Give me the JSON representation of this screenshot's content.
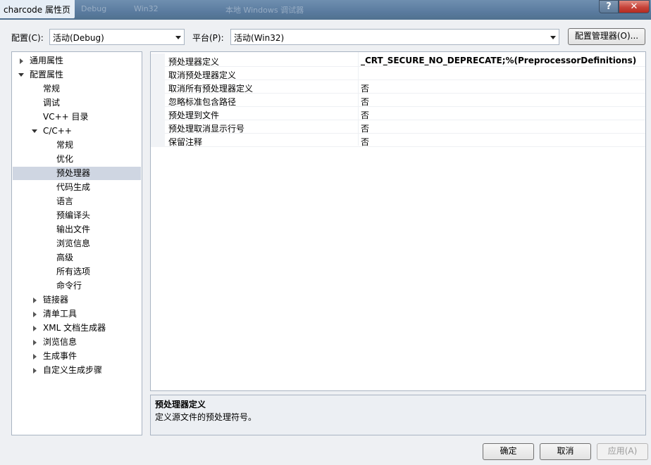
{
  "window": {
    "title": "charcode 属性页",
    "help_label": "?",
    "close_label": "✕"
  },
  "background_ghost": [
    "Debug",
    "Win32",
    "本地 Windows 调试器"
  ],
  "config_row": {
    "config_label": "配置(C):",
    "config_value": "活动(Debug)",
    "platform_label": "平台(P):",
    "platform_value": "活动(Win32)",
    "manager_button": "配置管理器(O)..."
  },
  "tree": {
    "items": [
      {
        "label": "通用属性",
        "expander": "closed"
      },
      {
        "label": "配置属性",
        "expander": "open"
      },
      {
        "label": "常规"
      },
      {
        "label": "调试"
      },
      {
        "label": "VC++ 目录"
      },
      {
        "label": "C/C++",
        "expander": "open"
      },
      {
        "label": "常规"
      },
      {
        "label": "优化"
      },
      {
        "label": "预处理器",
        "selected": true
      },
      {
        "label": "代码生成"
      },
      {
        "label": "语言"
      },
      {
        "label": "预编译头"
      },
      {
        "label": "输出文件"
      },
      {
        "label": "浏览信息"
      },
      {
        "label": "高级"
      },
      {
        "label": "所有选项"
      },
      {
        "label": "命令行"
      },
      {
        "label": "链接器",
        "expander": "closed"
      },
      {
        "label": "清单工具",
        "expander": "closed"
      },
      {
        "label": "XML 文档生成器",
        "expander": "closed"
      },
      {
        "label": "浏览信息",
        "expander": "closed"
      },
      {
        "label": "生成事件",
        "expander": "closed"
      },
      {
        "label": "自定义生成步骤",
        "expander": "closed"
      }
    ]
  },
  "grid": {
    "rows": [
      {
        "name": "预处理器定义",
        "value": "_CRT_SECURE_NO_DEPRECATE;%(PreprocessorDefinitions)",
        "bold": true
      },
      {
        "name": "取消预处理器定义",
        "value": ""
      },
      {
        "name": "取消所有预处理器定义",
        "value": "否"
      },
      {
        "name": "忽略标准包含路径",
        "value": "否"
      },
      {
        "name": "预处理到文件",
        "value": "否"
      },
      {
        "name": "预处理取消显示行号",
        "value": "否"
      },
      {
        "name": "保留注释",
        "value": "否"
      }
    ]
  },
  "description": {
    "title": "预处理器定义",
    "text": "定义源文件的预处理符号。"
  },
  "buttons": {
    "ok": "确定",
    "cancel": "取消",
    "apply": "应用(A)"
  }
}
